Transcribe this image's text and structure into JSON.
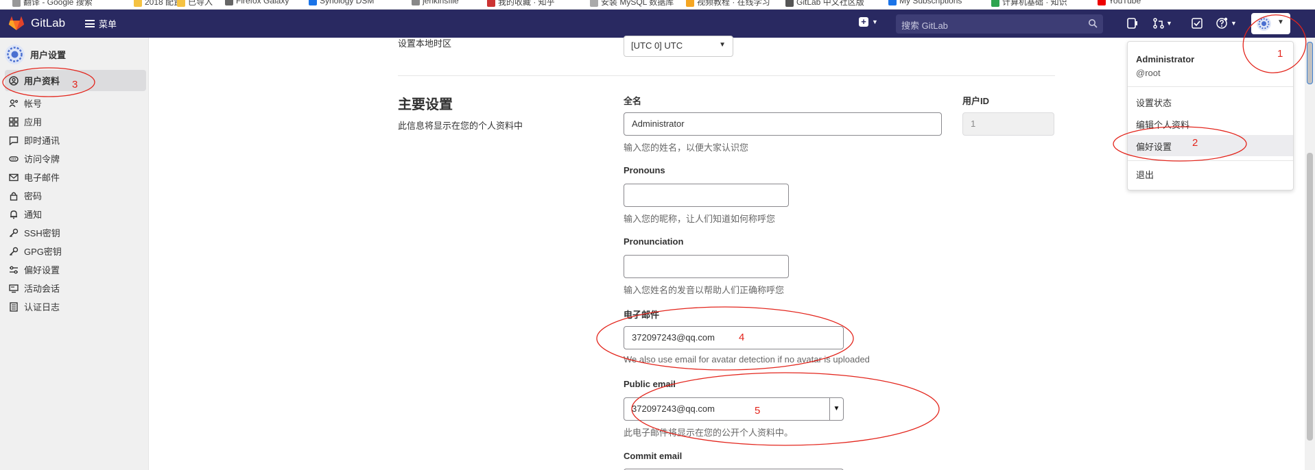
{
  "bookmarks": [
    "翻译 - Google 搜索",
    "2018 配置",
    "已导入",
    "Firefox Galaxy",
    "Synology DSM",
    "jenkinsfile",
    "我的收藏 · 知乎",
    "安装 MySQL 数据库",
    "视频教程 · 在线学习",
    "GitLab 中文社区版",
    "My Subscriptions",
    "计算机基础 · 知识",
    "YouTube"
  ],
  "navbar": {
    "brand": "GitLab",
    "menu_label": "菜单",
    "search_placeholder": "搜索 GitLab"
  },
  "sidebar": {
    "title": "用户设置",
    "items": [
      {
        "label": "用户资料",
        "icon": "profile-icon",
        "active": true
      },
      {
        "label": "帐号",
        "icon": "account-icon"
      },
      {
        "label": "应用",
        "icon": "applications-icon"
      },
      {
        "label": "即时通讯",
        "icon": "chat-icon"
      },
      {
        "label": "访问令牌",
        "icon": "token-icon"
      },
      {
        "label": "电子邮件",
        "icon": "mail-icon"
      },
      {
        "label": "密码",
        "icon": "lock-icon"
      },
      {
        "label": "通知",
        "icon": "bell-icon"
      },
      {
        "label": "SSH密钥",
        "icon": "key-icon"
      },
      {
        "label": "GPG密钥",
        "icon": "key-icon"
      },
      {
        "label": "偏好设置",
        "icon": "preferences-icon"
      },
      {
        "label": "活动会话",
        "icon": "monitor-icon"
      },
      {
        "label": "认证日志",
        "icon": "log-icon"
      }
    ]
  },
  "main": {
    "timezone_label": "设置本地时区",
    "timezone_value": "[UTC 0] UTC",
    "section_title": "主要设置",
    "section_desc": "此信息将显示在您的个人资料中",
    "fullname_label": "全名",
    "fullname_value": "Administrator",
    "fullname_help": "输入您的姓名，以便大家认识您",
    "userid_label": "用户ID",
    "userid_value": "1",
    "pronouns_label": "Pronouns",
    "pronouns_help": "输入您的昵称，让人们知道如何称呼您",
    "pronunciation_label": "Pronunciation",
    "pronunciation_help": "输入您姓名的发音以帮助人们正确称呼您",
    "email_label": "电子邮件",
    "email_value": "372097243@qq.com",
    "email_help": "We also use email for avatar detection if no avatar is uploaded",
    "public_email_label": "Public email",
    "public_email_value": "372097243@qq.com",
    "public_email_help": "此电子邮件将显示在您的公开个人资料中。",
    "commit_email_label": "Commit email"
  },
  "dropdown": {
    "name": "Administrator",
    "username": "@root",
    "items": [
      "设置状态",
      "编辑个人资料",
      "偏好设置",
      "退出"
    ]
  },
  "annotations": [
    "1",
    "2",
    "3",
    "4",
    "5"
  ],
  "colors": {
    "navbar": "#292961",
    "annotation": "#e3241b",
    "search": "#3d3d75"
  }
}
